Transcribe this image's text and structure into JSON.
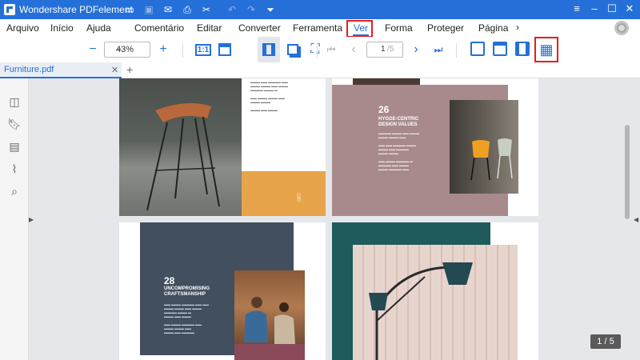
{
  "app": {
    "title": "Wondershare PDFelement"
  },
  "menu": {
    "items": [
      "Arquivo",
      "Início",
      "Ajuda",
      "Comentário",
      "Editar",
      "Converter",
      "Ferramenta",
      "Ver",
      "Forma",
      "Proteger",
      "Página"
    ],
    "active": "Ver"
  },
  "toolbar": {
    "zoom": "43%",
    "page_current": "1",
    "page_total": "/5"
  },
  "tabs": {
    "file": "Furniture.pdf"
  },
  "pages": {
    "p26_number": "26",
    "p26_heading": "HYGGE-CENTRIC DESIGN VALUES",
    "p28_number": "28",
    "p28_heading": "UNCOMPROMISING CRAFTSMANSHIP"
  },
  "status": {
    "page_counter": "1 / 5"
  },
  "colors": {
    "brand": "#2470d8",
    "highlight": "#e02020"
  }
}
